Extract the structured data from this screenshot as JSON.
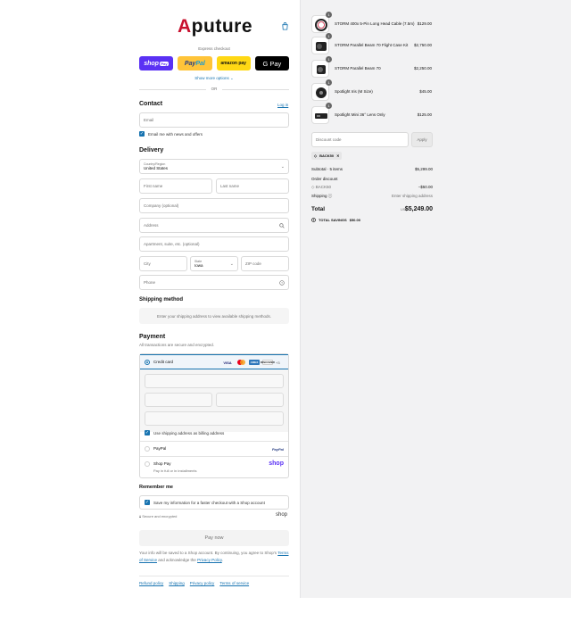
{
  "header": {
    "brand": "Aputure",
    "brand_initial": "A",
    "brand_rest": "puture",
    "cart_icon": "shopping-bag-icon"
  },
  "express": {
    "label": "Express checkout",
    "shop_label": "shop",
    "shop_pill": "Pay",
    "paypal_pay": "Pay",
    "paypal_pal": "Pal",
    "amazon_label": "amazon pay",
    "gpay_label": "G Pay",
    "show_more": "Show more options ⌄",
    "or": "OR"
  },
  "contact": {
    "title": "Contact",
    "login": "Log in",
    "email_placeholder": "Email",
    "news_label": "Email me with news and offers"
  },
  "delivery": {
    "title": "Delivery",
    "country_label": "Country/Region",
    "country_value": "United States",
    "first_name": "First name",
    "last_name": "Last name",
    "company": "Company (optional)",
    "address": "Address",
    "apartment": "Apartment, suite, etc. (optional)",
    "city": "City",
    "state_label": "State",
    "state_value": "Iowa",
    "zip": "ZIP code",
    "phone": "Phone"
  },
  "shipping_method": {
    "title": "Shipping method",
    "message": "Enter your shipping address to view available shipping methods."
  },
  "payment": {
    "title": "Payment",
    "subtitle": "All transactions are secure and encrypted.",
    "credit_card": "Credit card",
    "card_logos": [
      "VISA",
      "Mastercard",
      "AMEX",
      "DISCOVER"
    ],
    "more_cards": "+3",
    "billing_label": "Use shipping address as billing address",
    "paypal_label": "PayPal",
    "paypal_logo": "PayPal",
    "shop_pay_label": "Shop Pay",
    "shop_pay_sub": "Pay in full or in installments",
    "shop_logo": "shop"
  },
  "remember": {
    "title": "Remember me",
    "save_label": "Save my information for a faster checkout with a Shop account",
    "secure": "Secure and encrypted",
    "shop_word": "shop"
  },
  "pay_now": "Pay now",
  "legal": {
    "text1": "Your info will be saved to a Shop account. By continuing, you agree to Shop's ",
    "terms": "Terms of Service",
    "text2": " and acknowledge the ",
    "privacy": "Privacy Policy",
    "text3": "."
  },
  "footer": {
    "links": [
      "Refund policy",
      "Shipping",
      "Privacy policy",
      "Terms of service"
    ]
  },
  "order": {
    "items": [
      {
        "name": "STORM 400x 5-Pin Long Head Cable (7.5m)",
        "qty": "1",
        "price": "$129.00"
      },
      {
        "name": "STORM Parallel Beam 70 Flight Case Kit",
        "qty": "1",
        "price": "$2,750.00"
      },
      {
        "name": "STORM Parallel Beam 70",
        "qty": "1",
        "price": "$2,250.00"
      },
      {
        "name": "Spotlight Iris (M Size)",
        "qty": "1",
        "price": "$45.00"
      },
      {
        "name": "Spotlight Mini 36° Lens Only",
        "qty": "1",
        "price": "$125.00"
      }
    ],
    "discount_placeholder": "Discount code",
    "apply": "Apply",
    "applied_code": "BACK50",
    "subtotal_label": "Subtotal · 5 items",
    "subtotal_value": "$5,299.00",
    "order_discount_label": "Order discount",
    "code_tag": "BACK50",
    "discount_value": "−$50.00",
    "shipping_label": "Shipping",
    "shipping_value": "Enter shipping address",
    "total_label": "Total",
    "total_currency": "USD",
    "total_value": "$5,249.00",
    "savings_label": "TOTAL SAVINGS",
    "savings_value": "$50.00"
  }
}
